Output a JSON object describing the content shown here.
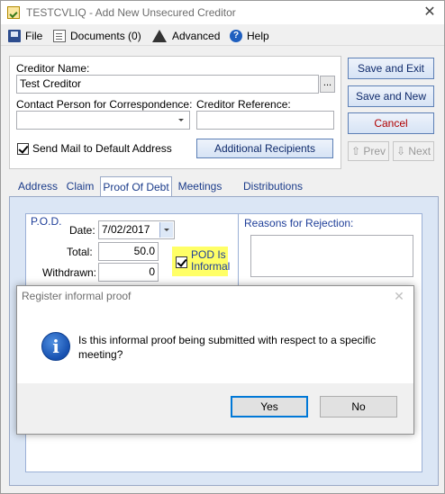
{
  "window": {
    "title": "TESTCVLIQ - Add New Unsecured Creditor",
    "close_glyph": "✕"
  },
  "menu": [
    {
      "label": "File",
      "icon": "file-icon"
    },
    {
      "label": "Documents (0)",
      "icon": "documents-icon"
    },
    {
      "label": "Advanced",
      "icon": "wizard-hat-icon"
    },
    {
      "label": "Help",
      "icon": "help-icon"
    }
  ],
  "form": {
    "creditor_name_label": "Creditor Name:",
    "creditor_name_value": "Test Creditor",
    "ellipsis": "...",
    "contact_label": "Contact Person for Correspondence:",
    "contact_value": "",
    "reference_label": "Creditor Reference:",
    "reference_value": "",
    "send_mail_label": "Send Mail to Default Address",
    "send_mail_checked": true,
    "additional_recipients": "Additional Recipients"
  },
  "actions": {
    "save_exit": "Save and Exit",
    "save_new": "Save and New",
    "cancel": "Cancel",
    "prev": "Prev",
    "next": "Next"
  },
  "tabs": [
    "Address",
    "Claim",
    "Proof Of Debt",
    "Meetings",
    "Distributions"
  ],
  "active_tab": "Proof Of Debt",
  "pod": {
    "section_label": "P.O.D.",
    "date_label": "Date:",
    "date_value": "7/02/2017",
    "total_label": "Total:",
    "total_value": "50.0",
    "withdrawn_label": "Withdrawn:",
    "withdrawn_value": "0",
    "informal_label_line1": "POD Is",
    "informal_label_line2": "Informal",
    "informal_checked": true,
    "rejection_label": "Reasons for Rejection:"
  },
  "dialog": {
    "title": "Register informal proof",
    "message": "Is this informal proof being submitted with respect to a specific meeting?",
    "icon": "info-icon",
    "icon_glyph": "i",
    "yes": "Yes",
    "no": "No"
  }
}
